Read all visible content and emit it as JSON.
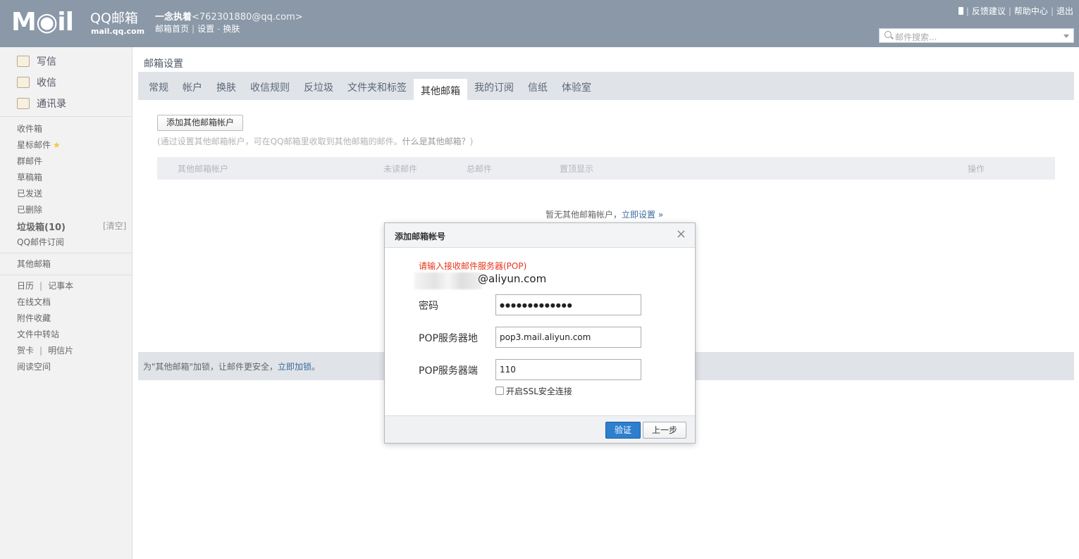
{
  "header": {
    "logo_text": "M◉il",
    "logo_name": "QQ邮箱",
    "logo_domain": "mail.qq.com",
    "user_nick": "一念执着",
    "user_email": "<762301880@qq.com>",
    "links": [
      "邮箱首页",
      "设置",
      "换肤"
    ],
    "right_links": [
      "反馈建议",
      "帮助中心",
      "退出"
    ],
    "search_placeholder": "邮件搜索..."
  },
  "sidebar": {
    "compose": "写信",
    "receive": "收信",
    "contacts": "通讯录",
    "folders": [
      "收件箱",
      "星标邮件",
      "群邮件",
      "草稿箱",
      "已发送",
      "已删除",
      "垃圾箱(10)",
      "QQ邮件订阅"
    ],
    "clear_label": "[清空]",
    "other_mail": "其他邮箱",
    "tools": [
      "日历",
      "记事本",
      "在线文档",
      "附件收藏",
      "文件中转站",
      "贺卡",
      "明信片",
      "阅读空间"
    ]
  },
  "main": {
    "page_title": "邮箱设置",
    "tabs": [
      "常规",
      "帐户",
      "换肤",
      "收信规则",
      "反垃圾",
      "文件夹和标签",
      "其他邮箱",
      "我的订阅",
      "信纸",
      "体验室"
    ],
    "active_tab": "其他邮箱",
    "add_button": "添加其他邮箱帐户",
    "hint_prefix": "(通过设置其他邮箱帐户，可在QQ邮箱里收取到其他邮箱的邮件。",
    "hint_link": "什么是其他邮箱？",
    "hint_suffix": ")",
    "table_headers": [
      "其他邮箱帐户",
      "未读邮件",
      "总邮件",
      "置顶显示",
      "操作"
    ],
    "empty_text": "暂无其他邮箱帐户，",
    "empty_link": "立即设置 »",
    "lock_text": "为\"其他邮箱\"加锁，让邮件更安全，",
    "lock_link": "立即加锁。"
  },
  "dialog": {
    "title": "添加邮箱帐号",
    "close": "×",
    "error": "请输入接收邮件服务器(POP)",
    "account_suffix": "@aliyun.com",
    "password_label": "密码",
    "password_value": "●●●●●●●●●●●●●",
    "pop_server_label": "POP服务器地",
    "pop_server_value": "pop3.mail.aliyun.com",
    "pop_port_label": "POP服务器端",
    "pop_port_value": "110",
    "ssl_label": "开启SSL安全连接",
    "verify_button": "验证",
    "back_button": "上一步"
  }
}
